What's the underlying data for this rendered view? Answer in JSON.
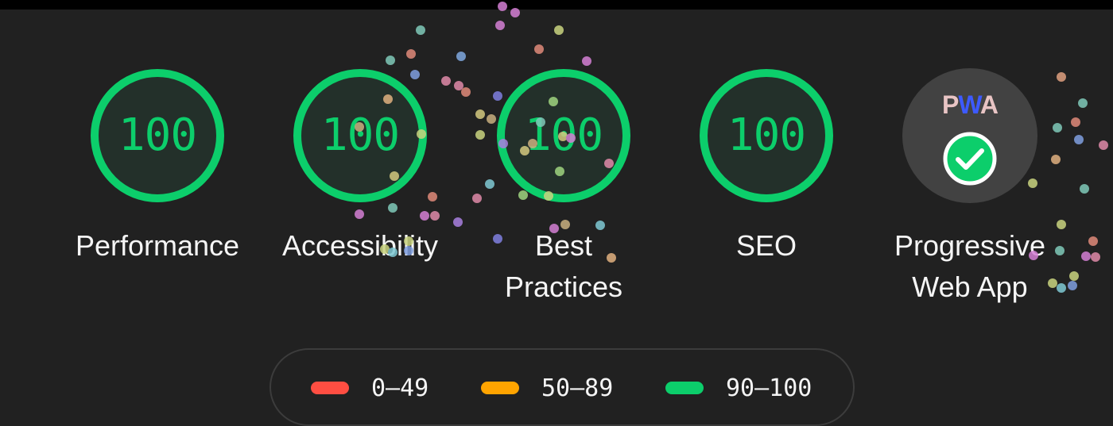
{
  "colors": {
    "background": "#212121",
    "pass": "#0cce6b",
    "average": "#ffa400",
    "fail": "#ff4e42",
    "gauge_fill": "#23302a",
    "pwa_badge": "#424242"
  },
  "categories": [
    {
      "id": "performance",
      "score": "100",
      "label": "Performance"
    },
    {
      "id": "accessibility",
      "score": "100",
      "label": "Accessibility"
    },
    {
      "id": "best-practices",
      "score": "100",
      "label_line1": "Best",
      "label_line2": "Practices"
    },
    {
      "id": "seo",
      "score": "100",
      "label": "SEO"
    }
  ],
  "pwa": {
    "badge_text": "PWA",
    "badge_icon": "check-circle-icon",
    "label_line1": "Progressive",
    "label_line2": "Web App"
  },
  "legend": [
    {
      "range": "0–49",
      "color": "#ff4e42"
    },
    {
      "range": "50–89",
      "color": "#ffa400"
    },
    {
      "range": "90–100",
      "color": "#0cce6b"
    }
  ]
}
